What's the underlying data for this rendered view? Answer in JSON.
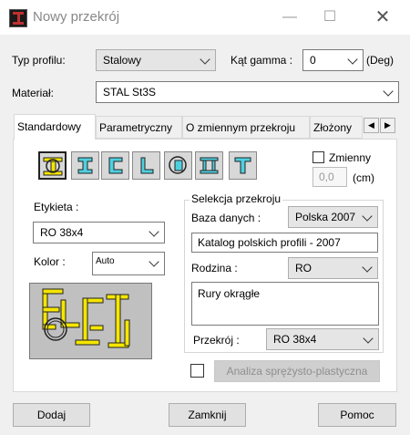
{
  "window": {
    "title": "Nowy przekrój",
    "minimize_icon": "—",
    "maximize_icon": "☐",
    "close_icon": "✕"
  },
  "form": {
    "profile_type_label": "Typ profilu:",
    "profile_type_value": "Stalowy",
    "gamma_label": "Kąt gamma :",
    "gamma_value": "0",
    "gamma_unit": "(Deg)",
    "material_label": "Materiał:",
    "material_value": "STAL St3S"
  },
  "tabs": [
    {
      "label": "Standardowy",
      "active": true
    },
    {
      "label": "Parametryczny"
    },
    {
      "label": "O zmiennym przekroju"
    },
    {
      "label": "Złożony"
    }
  ],
  "tab_scroll": {
    "left": "◀",
    "right": "▶"
  },
  "standard_tab": {
    "profile_shapes": [
      "tube-pipe-icon",
      "i-section-icon",
      "channel-section-icon",
      "angle-section-icon",
      "round-tube-icon",
      "double-channel-icon",
      "tee-section-icon"
    ],
    "variable_label": "Zmienny",
    "variable_value": "0,0",
    "variable_unit": "(cm)",
    "label_label": "Etykieta :",
    "label_value": "RO 38x4",
    "color_label": "Kolor :",
    "color_value": "Auto",
    "selection_group": "Selekcja przekroju",
    "database_label": "Baza danych :",
    "database_value": "Polska 2007",
    "catalog_value": "Katalog polskich profili - 2007",
    "family_label": "Rodzina :",
    "family_value": "RO",
    "family_description": "Rury okrągłe",
    "section_label": "Przekrój :",
    "section_value": "RO 38x4",
    "analysis_button": "Analiza sprężysto-plastyczna"
  },
  "footer": {
    "add": "Dodaj",
    "close": "Zamknij",
    "help": "Pomoc"
  },
  "colors": {
    "accent": "#1979ca",
    "profile_yellow": "#f5e600",
    "preview_bg": "#c0c0c0"
  }
}
